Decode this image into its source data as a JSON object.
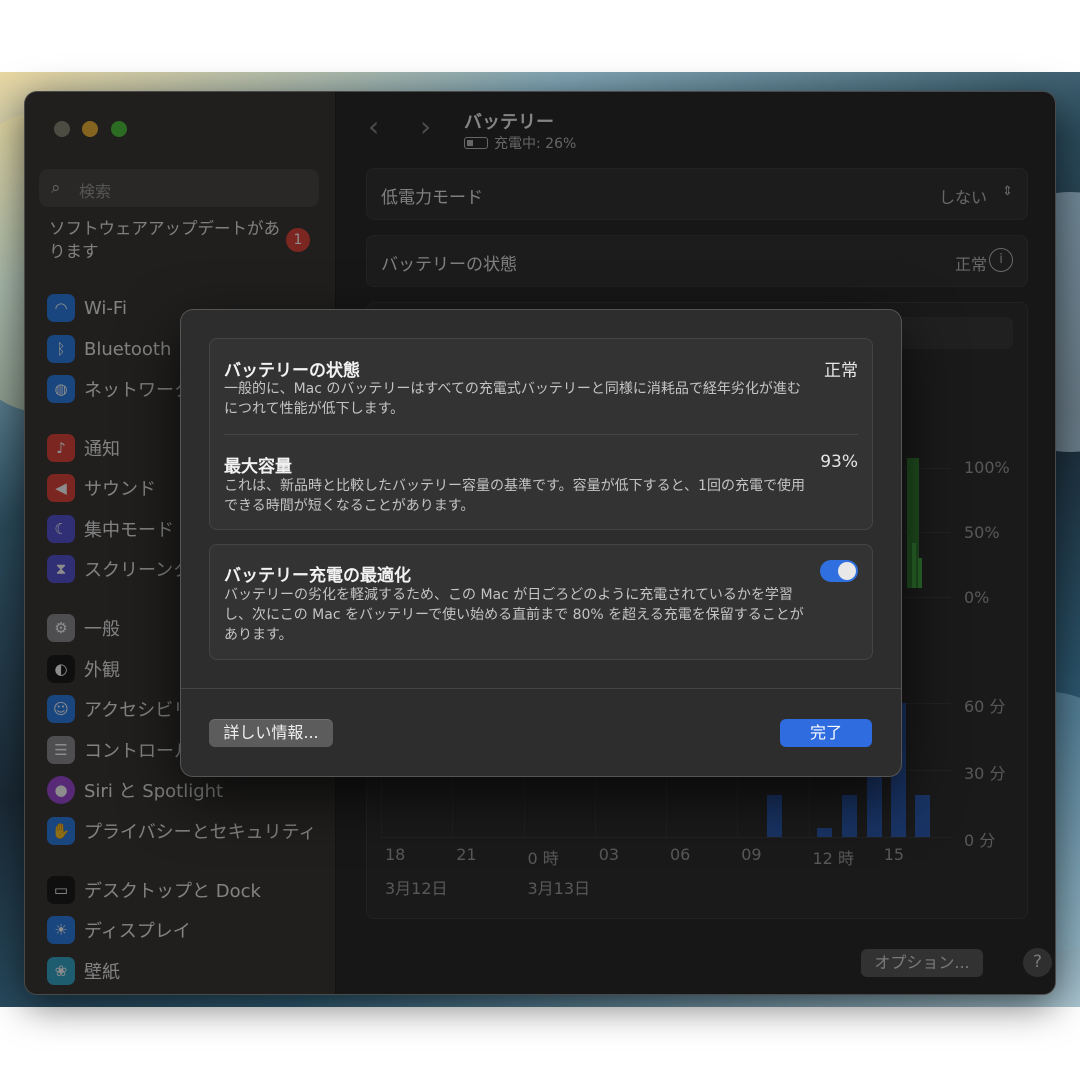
{
  "sidebar": {
    "search_placeholder": "検索",
    "update_notice": "ソフトウェアアップデートがあります",
    "update_badge": "1",
    "items": [
      {
        "label": "Wi-Fi",
        "icon": "wifi-icon",
        "color": "#2f7fe8"
      },
      {
        "label": "Bluetooth",
        "icon": "bluetooth-icon",
        "color": "#2f7fe8"
      },
      {
        "label": "ネットワーク",
        "icon": "globe-icon",
        "color": "#2f7fe8"
      },
      {
        "label": "通知",
        "icon": "bell-icon",
        "color": "#e0463c"
      },
      {
        "label": "サウンド",
        "icon": "speaker-icon",
        "color": "#e0463c"
      },
      {
        "label": "集中モード",
        "icon": "moon-icon",
        "color": "#5856d6"
      },
      {
        "label": "スクリーンタイム",
        "icon": "hourglass-icon",
        "color": "#5856d6"
      },
      {
        "label": "一般",
        "icon": "gear-icon",
        "color": "#8e8e93"
      },
      {
        "label": "外観",
        "icon": "appearance-icon",
        "color": "#1c1c1e"
      },
      {
        "label": "アクセシビリティ",
        "icon": "accessibility-icon",
        "color": "#2f7fe8"
      },
      {
        "label": "コントロールセンター",
        "icon": "control-center-icon",
        "color": "#8e8e93"
      },
      {
        "label": "Siri と Spotlight",
        "icon": "siri-icon",
        "color": "#a04ad8"
      },
      {
        "label": "プライバシーとセキュリティ",
        "icon": "hand-icon",
        "color": "#2f7fe8"
      },
      {
        "label": "デスクトップと Dock",
        "icon": "dock-icon",
        "color": "#1c1c1e"
      },
      {
        "label": "ディスプレイ",
        "icon": "sun-icon",
        "color": "#2f7fe8"
      },
      {
        "label": "壁紙",
        "icon": "wallpaper-icon",
        "color": "#36a7c9"
      }
    ]
  },
  "header": {
    "title": "バッテリー",
    "status": "充電中: 26%"
  },
  "settings": {
    "low_power_label": "低電力モード",
    "low_power_value": "しない",
    "health_label": "バッテリーの状態",
    "health_value": "正常"
  },
  "chart_data": [
    {
      "type": "bar",
      "title": "",
      "y_ticks": [
        "100%",
        "50%",
        "0%"
      ],
      "note": "battery level chart largely hidden behind dialog"
    },
    {
      "type": "bar",
      "y_ticks": [
        "60 分",
        "30 分",
        "0 分"
      ],
      "x_ticks": [
        "18",
        "21",
        "0 時",
        "03",
        "06",
        "09",
        "12 時",
        "15"
      ],
      "x_dates": [
        "3月12日",
        "3月13日"
      ],
      "ylim": [
        0,
        60
      ],
      "values": [
        19,
        4,
        19,
        28,
        60,
        19
      ]
    }
  ],
  "footer": {
    "options_label": "オプション...",
    "help_label": "?"
  },
  "dialog": {
    "health_title": "バッテリーの状態",
    "health_value": "正常",
    "health_desc": "一般的に、Mac のバッテリーはすべての充電式バッテリーと同様に消耗品で経年劣化が進むにつれて性能が低下します。",
    "capacity_title": "最大容量",
    "capacity_value": "93%",
    "capacity_desc": "これは、新品時と比較したバッテリー容量の基準です。容量が低下すると、1回の充電で使用できる時間が短くなることがあります。",
    "optimize_title": "バッテリー充電の最適化",
    "optimize_on": true,
    "optimize_desc": "バッテリーの劣化を軽減するため、この Mac が日ごろどのように充電されているかを学習し、次にこの Mac をバッテリーで使い始める直前まで 80% を超える充電を保留することがあります。",
    "more_info_label": "詳しい情報...",
    "done_label": "完了"
  }
}
